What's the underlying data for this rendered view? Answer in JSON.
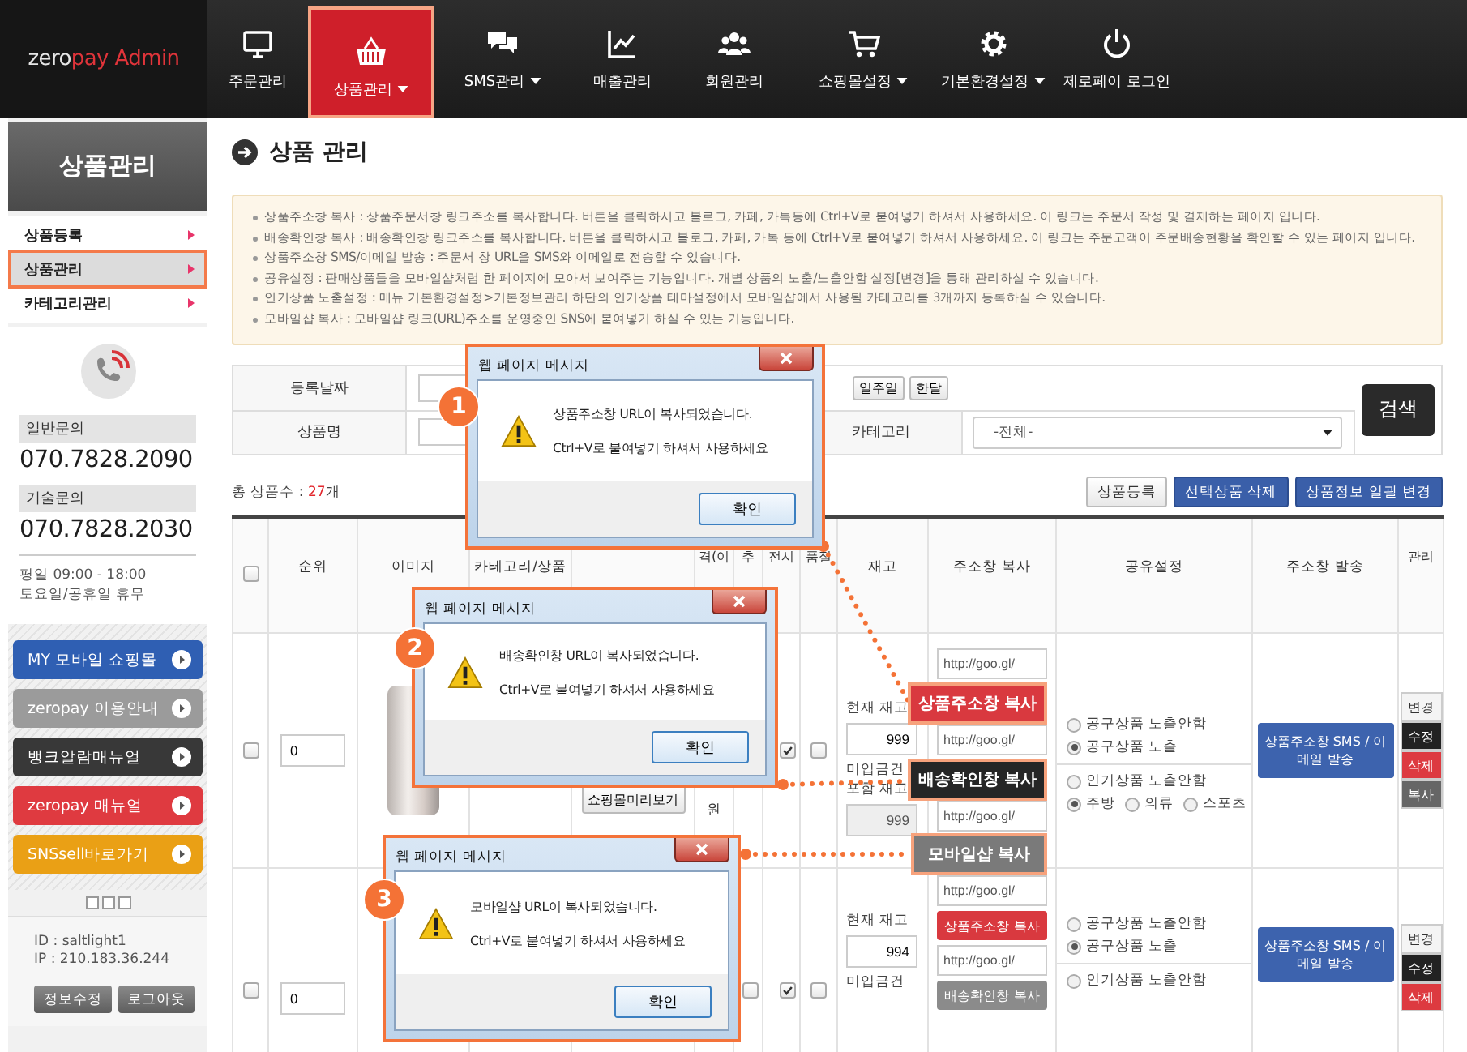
{
  "topbar": {
    "logo": {
      "part_1": "zero",
      "part_2": "pay Admin"
    },
    "nav": [
      {
        "label": "주문관리",
        "selected": false,
        "dropdown": false
      },
      {
        "label": "상품관리",
        "selected": true,
        "dropdown": true
      },
      {
        "label": "SMS관리",
        "selected": false,
        "dropdown": true
      },
      {
        "label": "매출관리",
        "selected": false,
        "dropdown": false
      },
      {
        "label": "회원관리",
        "selected": false,
        "dropdown": false
      },
      {
        "label": "쇼핑몰설정",
        "selected": false,
        "dropdown": true
      },
      {
        "label": "기본환경설정",
        "selected": false,
        "dropdown": true
      },
      {
        "label": "제로페이 로그인",
        "selected": false,
        "dropdown": false
      }
    ]
  },
  "sidebar": {
    "title": "상품관리",
    "menu": [
      {
        "label": "상품등록",
        "selected": false
      },
      {
        "label": "상품관리",
        "selected": true
      },
      {
        "label": "카테고리관리",
        "selected": false
      }
    ],
    "contact": {
      "general_label": "일반문의",
      "general_phone": "070.7828.2090",
      "tech_label": "기술문의",
      "tech_phone": "070.7828.2030",
      "hours": [
        "평일 09:00 - 18:00",
        "토요일/공휴일 휴무"
      ]
    },
    "banners": [
      {
        "label": "MY 모바일 쇼핑몰",
        "color": "#2f5fb3"
      },
      {
        "label": "zeropay 이용안내",
        "color": "#9b9b9b"
      },
      {
        "label": "뱅크알람매뉴얼",
        "color": "#383838"
      },
      {
        "label": "zeropay 매뉴얼",
        "color": "#df3a40"
      },
      {
        "label": "SNSsell바로가기",
        "color": "#eaa015"
      }
    ],
    "account": [
      "ID : saltlight1",
      "IP : 210.183.36.244"
    ],
    "buttons": [
      "정보수정",
      "로그아웃"
    ]
  },
  "main": {
    "title": "상품 관리",
    "notices": [
      "상품주소창 복사 : 상품주문서창 링크주소를 복사합니다. 버튼을 클릭하시고 블로그, 카페, 카톡등에 Ctrl+V로 붙여넣기 하셔서 사용하세요. 이 링크는 주문서 작성 및 결제하는 페이지 입니다.",
      "배송확인창 복사 : 배송확인창 링크주소를 복사합니다. 버튼을 클릭하시고 블로그, 카페, 카톡 등에 Ctrl+V로 붙여넣기 하셔서 사용하세요. 이 링크는 주문고객이 주문배송현황을 확인할 수 있는 페이지 입니다.",
      "상품주소창 SMS/이메일 발송 : 주문서 창 URL을 SMS와 이메일로 전송할 수 있습니다.",
      "공유설정 : 판매상품들을 모바일샵처럼 한 페이지에 모아서 보여주는 기능입니다. 개별 상품의 노출/노출안함 설정[변경]을 통해 관리하실 수 있습니다.",
      "인기상품 노출설정 : 메뉴 기본환경설정>기본정보관리 하단의 인기상품 테마설정에서 모바일샵에서 사용될 카테고리를 3개까지 등록하실 수 있습니다.",
      "모바일샵 복사 : 모바일샵 링크(URL)주소를 운영중인 SNS에 붙여넣기 하실 수 있는 기능입니다."
    ],
    "search": {
      "date_label": "등록날짜",
      "quick_buttons": [
        "일주일",
        "한달"
      ],
      "name_label": "상품명",
      "category_label": "카테고리",
      "category_value": "-전체-",
      "search_button": "검색"
    },
    "total": {
      "label": "총 상품수 :",
      "count": "27",
      "unit": "개"
    },
    "actions": [
      {
        "label": "상품등록",
        "kind": "light"
      },
      {
        "label": "선택상품 삭제",
        "kind": "primary"
      },
      {
        "label": "상품정보 일괄 변경",
        "kind": "primary"
      }
    ],
    "table": {
      "columns": [
        {
          "kind": "checkbox",
          "checked": false
        },
        {
          "kind": "text",
          "label": "순위"
        },
        {
          "kind": "text",
          "label": "이미지"
        },
        {
          "kind": "text",
          "label": "카테고리/상품"
        },
        {
          "kind": "text"
        },
        {
          "kind": "text",
          "label": "격(이"
        },
        {
          "kind": "text",
          "label": "추"
        },
        {
          "kind": "text",
          "label": "전시"
        },
        {
          "kind": "text",
          "label": "품절"
        },
        {
          "kind": "text",
          "label": "재고"
        },
        {
          "kind": "text",
          "label": "주소창 복사"
        },
        {
          "kind": "text",
          "label": "공유설정"
        },
        {
          "kind": "text",
          "label": "주소창 발송"
        },
        {
          "kind": "text",
          "label": "관리"
        }
      ],
      "rows": [
        {
          "selected": false,
          "rank": "0",
          "photo": true,
          "preview_button": "쇼핑몰미리보기",
          "price_fragment": "원",
          "display_checked": true,
          "soldout_checked": false,
          "stock_label": "현재 재고",
          "stock": "999",
          "stock2_label": "미입금건 포함 재고",
          "stock2": "999",
          "urls": [
            "http://goo.gl/",
            "http://goo.gl/",
            "http://goo.gl/"
          ],
          "share_groups": [
            [
              [
                {
                  "label": "공구상품 노출안함",
                  "checked": false
                }
              ],
              [
                {
                  "label": "공구상품 노출",
                  "checked": true
                }
              ]
            ],
            [
              [
                {
                  "label": "인기상품 노출안함",
                  "checked": false
                }
              ],
              [
                {
                  "label": "주방",
                  "checked": true
                },
                {
                  "label": "의류",
                  "checked": false
                },
                {
                  "label": "스포츠",
                  "checked": false
                }
              ]
            ]
          ],
          "send_button": "상품주소창 SMS / 이메일 발송",
          "manage": [
            {
              "label": "변경",
              "kind": "light"
            },
            {
              "label": "수정",
              "kind": "dark"
            },
            {
              "label": "삭제",
              "kind": "danger"
            },
            {
              "label": "복사",
              "kind": "muted"
            }
          ]
        },
        {
          "selected": false,
          "rank": "0",
          "photo": false,
          "extra_checked": false,
          "display_checked": true,
          "soldout_checked": false,
          "stock_label": "현재 재고",
          "stock": "994",
          "stock2_label": "미입금건",
          "urls": [
            "http://goo.gl/",
            "http://goo.gl/"
          ],
          "copy_buttons": [
            {
              "label": "상품주소창 복사",
              "kind": "red"
            },
            {
              "label": "배송확인창 복사",
              "kind": "gray"
            }
          ],
          "share_groups": [
            [
              [
                {
                  "label": "공구상품 노출안함",
                  "checked": false
                }
              ],
              [
                {
                  "label": "공구상품 노출",
                  "checked": true
                }
              ]
            ],
            [
              [
                {
                  "label": "인기상품 노출안함",
                  "checked": false
                }
              ]
            ]
          ],
          "send_button": "상품주소창 SMS / 이메일 발송",
          "manage": [
            {
              "label": "변경",
              "kind": "light"
            },
            {
              "label": "수정",
              "kind": "dark"
            },
            {
              "label": "삭제",
              "kind": "danger"
            }
          ]
        }
      ]
    }
  },
  "dialogs": [
    {
      "number": "1",
      "title": "웹 페이지 메시지",
      "message": "상품주소창 URL이 복사되었습니다.",
      "hint": "Ctrl+V로 붙여넣기 하셔서 사용하세요",
      "button": "확인"
    },
    {
      "number": "2",
      "title": "웹 페이지 메시지",
      "message": "배송확인창 URL이 복사되었습니다.",
      "hint": "Ctrl+V로 붙여넣기 하셔서 사용하세요",
      "button": "확인"
    },
    {
      "number": "3",
      "title": "웹 페이지 메시지",
      "message": "모바일샵 URL이 복사되었습니다.",
      "hint": "Ctrl+V로 붙여넣기 하셔서 사용하세요",
      "button": "확인"
    }
  ],
  "callouts": [
    {
      "label": "상품주소창 복사",
      "color": "#d9393f"
    },
    {
      "label": "배송확인창 복사",
      "color": "#262626"
    },
    {
      "label": "모바일샵 복사",
      "color": "#7a7a7a"
    }
  ]
}
